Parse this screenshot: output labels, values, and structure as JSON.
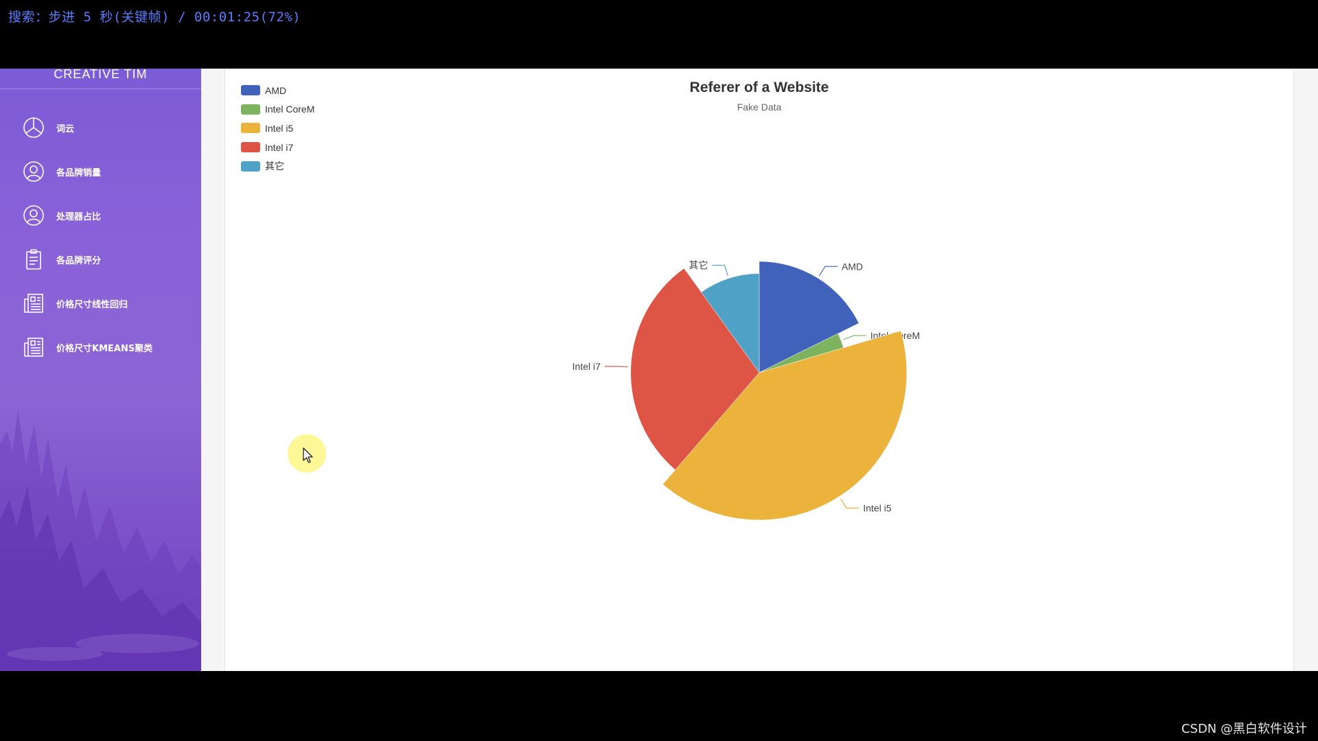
{
  "overlay": {
    "search_status": "搜索：步进 5 秒(关键帧) / 00:01:25(72%)"
  },
  "sidebar": {
    "brand": "CREATIVE TIM",
    "items": [
      {
        "label": "词云",
        "icon": "pie-chart-icon"
      },
      {
        "label": "各品牌销量",
        "icon": "user-icon"
      },
      {
        "label": "处理器占比",
        "icon": "user-icon"
      },
      {
        "label": "各品牌评分",
        "icon": "clipboard-icon"
      },
      {
        "label": "价格尺寸线性回归",
        "icon": "news-icon"
      },
      {
        "label": "价格尺寸KMEANS聚类",
        "icon": "news-icon"
      }
    ]
  },
  "chart_data": {
    "type": "pie",
    "title": "Referer of a Website",
    "subtitle": "Fake Data",
    "legend_position": "top-left",
    "categories": [
      "AMD",
      "Intel CoreM",
      "Intel i5",
      "Intel i7",
      "其它"
    ],
    "values": [
      16,
      2.5,
      37,
      26,
      9
    ],
    "colors": [
      "#4062bb",
      "#7db35f",
      "#ecb33c",
      "#de5546",
      "#4fa1c6"
    ]
  },
  "watermark": "CSDN @黑白软件设计"
}
